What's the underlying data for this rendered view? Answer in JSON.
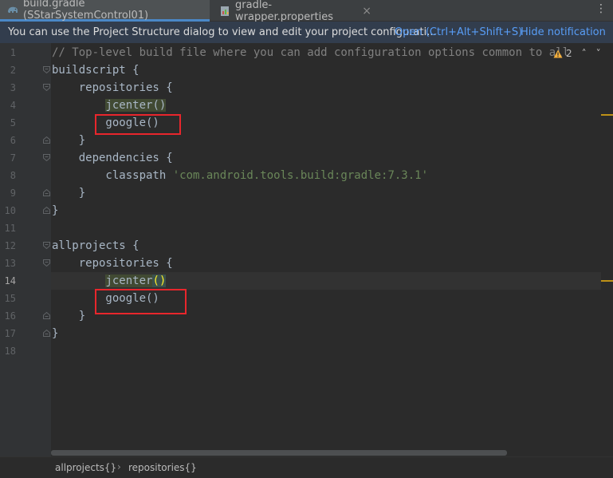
{
  "tabs": [
    {
      "label": "build.gradle (SStarSystemControl01)",
      "active": true
    },
    {
      "label": "gradle-wrapper.properties",
      "active": false
    }
  ],
  "tabbar": {
    "menu_glyph": "⋮",
    "close_glyph": "×"
  },
  "notification": {
    "message": "You can use the Project Structure dialog to view and edit your project configurati...",
    "open_link": "Open (Ctrl+Alt+Shift+S)",
    "hide_link": "Hide notification"
  },
  "inspection": {
    "warning_count": "2",
    "up": "˄",
    "down": "˅"
  },
  "line_numbers": [
    "1",
    "2",
    "3",
    "4",
    "5",
    "6",
    "7",
    "8",
    "9",
    "10",
    "11",
    "12",
    "13",
    "14",
    "15",
    "16",
    "17",
    "18"
  ],
  "code": {
    "line1": "// Top-level build file where you can add configuration options common to all",
    "line2": "buildscript {",
    "line3": "    repositories {",
    "line4_indent": "        ",
    "line4_call": "jcenter()",
    "line5": "        google()",
    "line6": "    }",
    "line7": "    dependencies {",
    "line8_prefix": "        classpath ",
    "line8_string": "'com.android.tools.build:gradle:7.3.1'",
    "line9": "    }",
    "line10": "}",
    "line12": "allprojects {",
    "line13": "    repositories {",
    "line14_indent": "        ",
    "line14_name": "jcenter",
    "line14_open": "(",
    "line14_close": ")",
    "line15": "        google()",
    "line16": "    }",
    "line17": "}"
  },
  "breadcrumb": {
    "items": [
      "allprojects{}",
      "repositories{}"
    ],
    "separator": "›"
  },
  "colors": {
    "accent": "#4a88c7",
    "link": "#589df6",
    "annotation_red": "#e8262c",
    "warning": "#be9117"
  }
}
